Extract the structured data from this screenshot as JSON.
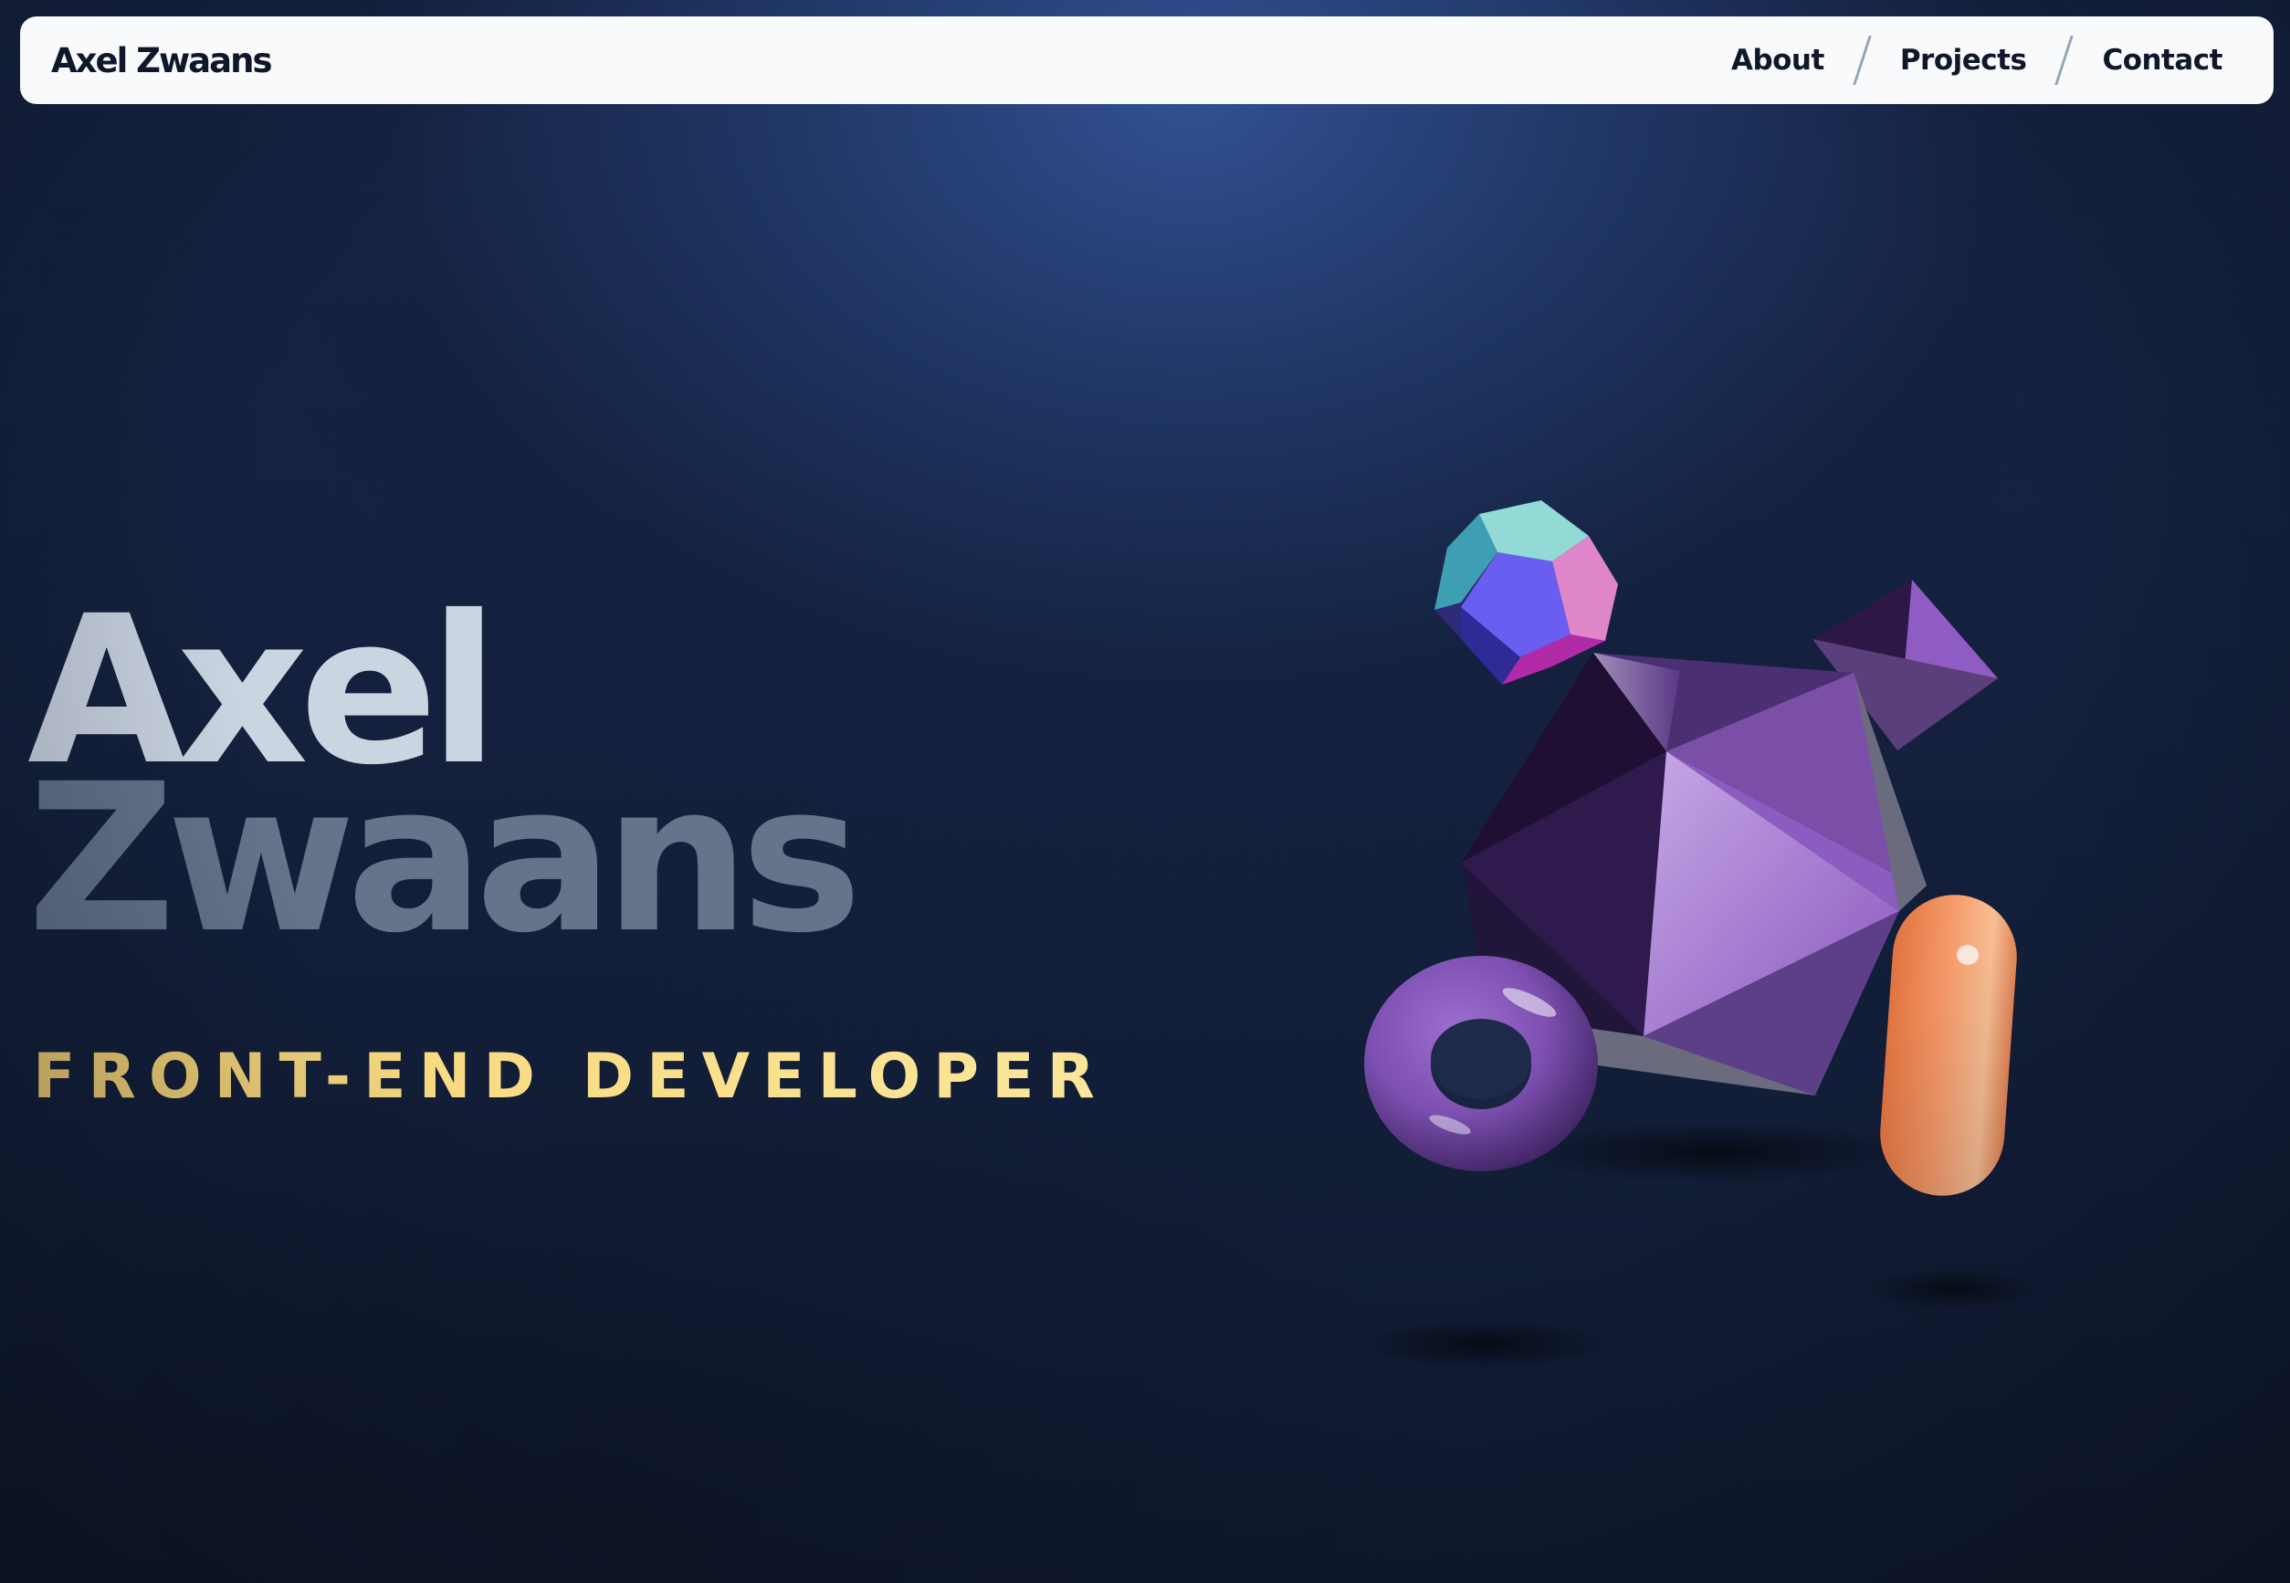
{
  "navbar": {
    "brand": "Axel Zwaans",
    "links": [
      {
        "label": "About"
      },
      {
        "label": "Projects"
      },
      {
        "label": "Contact"
      }
    ]
  },
  "hero": {
    "first_name": "Axel",
    "last_name": "Zwaans",
    "role": "FRONT-END DEVELOPER"
  },
  "scene": {
    "shapes": [
      "dodecahedron",
      "icosahedron",
      "tetrahedron",
      "torus",
      "capsule"
    ]
  },
  "colors": {
    "background": "#131f3a",
    "navbar": "#f8fafc",
    "text_dark": "#0f172a",
    "first_name": "#cbd5e1",
    "last_name": "#64748b",
    "role": "#f8d77a",
    "purple": "#7c4fa8",
    "orange": "#f59a6a"
  }
}
